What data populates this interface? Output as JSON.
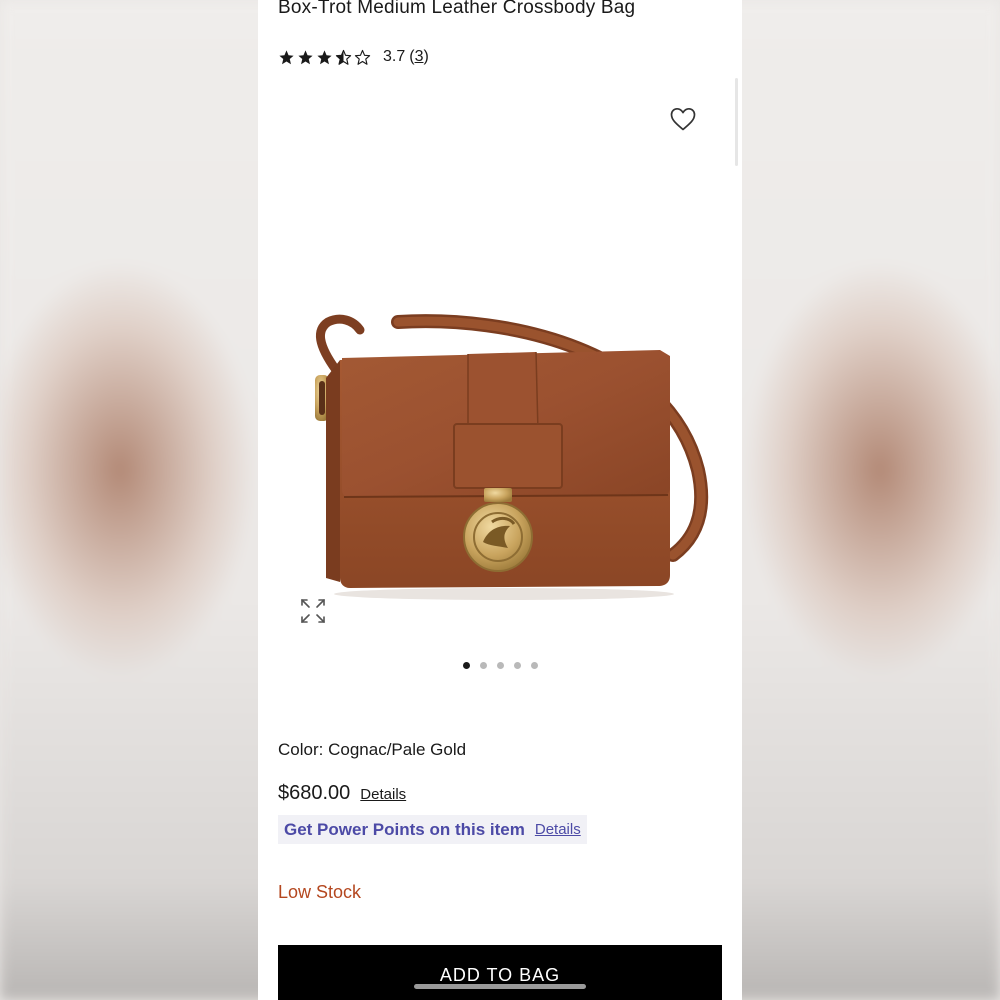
{
  "product": {
    "title": "Box-Trot Medium Leather Crossbody Bag",
    "rating_value": "3.7",
    "rating_open": "(",
    "rating_count": "3",
    "rating_close": ")",
    "rating_stars": 3.5
  },
  "gallery": {
    "image_count": 5,
    "active_index": 0
  },
  "icons": {
    "favorite": "heart-outline-icon",
    "expand": "expand-arrows-icon"
  },
  "details": {
    "color_label": "Color:",
    "color_value": "Cognac/Pale Gold",
    "price": "$680.00",
    "price_details_link": "Details",
    "power_points_text": "Get Power Points on this item",
    "power_points_link": "Details",
    "stock_status": "Low Stock"
  },
  "actions": {
    "add_to_bag": "ADD TO BAG"
  },
  "colors": {
    "brand_purple": "#4c4aa6",
    "stock_red": "#b4471f",
    "button_black": "#000000",
    "bag_cognac": "#9a4e2b"
  }
}
